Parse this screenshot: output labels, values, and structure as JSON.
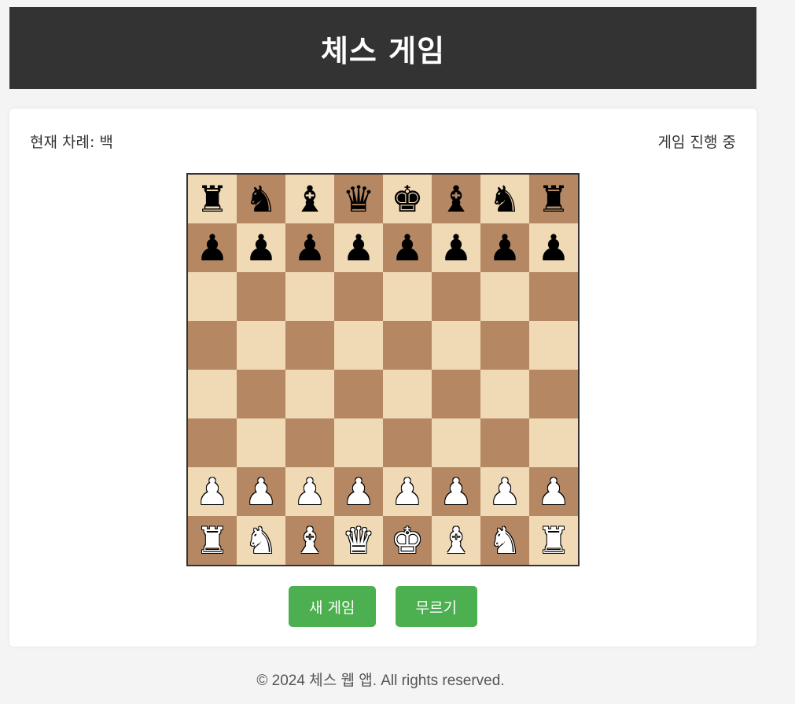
{
  "header": {
    "title": "체스 게임"
  },
  "status": {
    "turn_text": "현재 차례: 백",
    "game_state": "게임 진행 중"
  },
  "board": {
    "light_color": "#f0d9b5",
    "dark_color": "#b58863",
    "rows": [
      [
        "br",
        "bn",
        "bb",
        "bq",
        "bk",
        "bb",
        "bn",
        "br"
      ],
      [
        "bp",
        "bp",
        "bp",
        "bp",
        "bp",
        "bp",
        "bp",
        "bp"
      ],
      [
        "",
        "",
        "",
        "",
        "",
        "",
        "",
        ""
      ],
      [
        "",
        "",
        "",
        "",
        "",
        "",
        "",
        ""
      ],
      [
        "",
        "",
        "",
        "",
        "",
        "",
        "",
        ""
      ],
      [
        "",
        "",
        "",
        "",
        "",
        "",
        "",
        ""
      ],
      [
        "wp",
        "wp",
        "wp",
        "wp",
        "wp",
        "wp",
        "wp",
        "wp"
      ],
      [
        "wr",
        "wn",
        "wb",
        "wq",
        "wk",
        "wb",
        "wn",
        "wr"
      ]
    ],
    "glyphs": {
      "k": "♚",
      "q": "♛",
      "r": "♜",
      "b": "♝",
      "n": "♞",
      "p": "♟"
    },
    "piece_names": {
      "k": "king",
      "q": "queen",
      "r": "rook",
      "b": "bishop",
      "n": "knight",
      "p": "pawn"
    }
  },
  "actions": {
    "new_game_label": "새 게임",
    "undo_label": "무르기",
    "button_color": "#4caf50"
  },
  "footer": {
    "text": "© 2024 체스 웹 앱. All rights reserved."
  }
}
